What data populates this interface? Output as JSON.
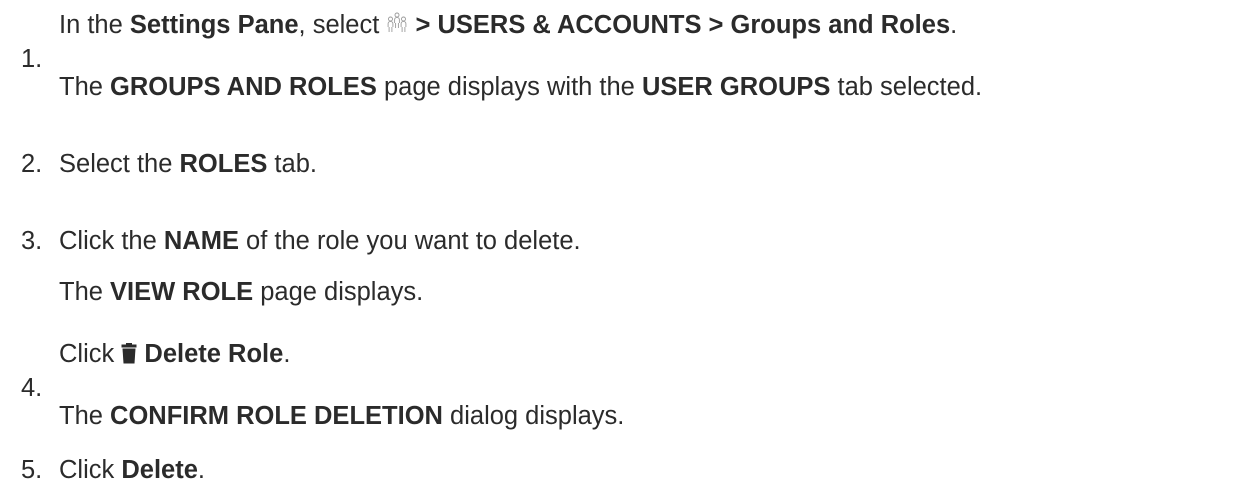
{
  "steps": [
    {
      "number": "1.",
      "lines": [
        {
          "t1": "In the ",
          "b1": "Settings Pane",
          "t2": ", select ",
          "icon": "users-accounts-icon",
          "b2": " > USERS & ACCOUNTS > Groups and Roles",
          "t3": "."
        },
        {
          "t1": "The ",
          "b1": "GROUPS AND ROLES",
          "t2": " page displays with the ",
          "b2": "USER GROUPS",
          "t3": " tab selected."
        }
      ]
    },
    {
      "number": "2.",
      "lines": [
        {
          "t1": "Select the ",
          "b1": "ROLES",
          "t2": " tab."
        }
      ]
    },
    {
      "number": "3.",
      "lines": [
        {
          "t1": "Click the ",
          "b1": "NAME",
          "t2": " of the role you want to delete."
        },
        {
          "t1": "The ",
          "b1": "VIEW ROLE",
          "t2": " page displays."
        }
      ]
    },
    {
      "number": "4.",
      "lines": [
        {
          "t1": "Click ",
          "icon": "trash-icon",
          "b1": " Delete Role",
          "t2": "."
        },
        {
          "t1": "The ",
          "b1": "CONFIRM ROLE DELETION",
          "t2": " dialog displays."
        }
      ]
    },
    {
      "number": "5.",
      "lines": [
        {
          "t1": "Click ",
          "b1": "Delete",
          "t2": "."
        }
      ]
    }
  ]
}
